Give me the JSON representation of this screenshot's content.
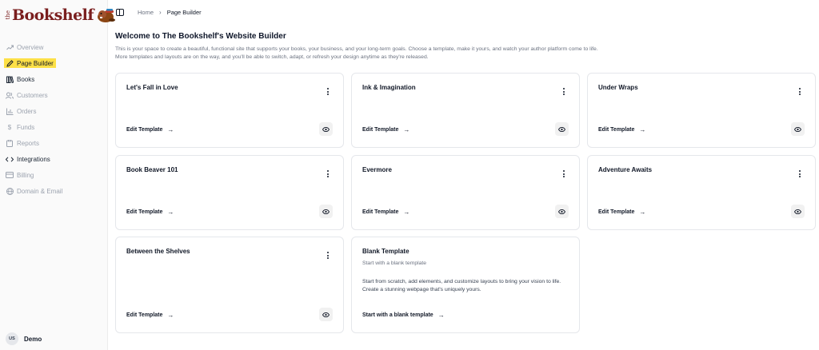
{
  "brand": {
    "the": "the",
    "name": "Bookshelf"
  },
  "sidebar": {
    "items": [
      {
        "label": "Overview",
        "icon": "trend-icon"
      },
      {
        "label": "Page Builder",
        "icon": "pencil-icon"
      },
      {
        "label": "Books",
        "icon": "books-icon"
      },
      {
        "label": "Customers",
        "icon": "users-icon"
      },
      {
        "label": "Orders",
        "icon": "bar-chart-icon"
      },
      {
        "label": "Funds",
        "icon": "dollar-icon"
      },
      {
        "label": "Reports",
        "icon": "clipboard-icon"
      },
      {
        "label": "Integrations",
        "icon": "code-arrows-icon"
      },
      {
        "label": "Billing",
        "icon": "credit-card-icon"
      },
      {
        "label": "Domain & Email",
        "icon": "globe-icon"
      }
    ],
    "user": {
      "initials": "US",
      "name": "Demo"
    }
  },
  "breadcrumb": {
    "home": "Home",
    "current": "Page Builder"
  },
  "main": {
    "title": "Welcome to The Bookshelf's Website Builder",
    "desc_line1": "This is your space to create a beautiful, functional site that supports your books, your business, and your long-term goals. Choose a template, make it yours, and watch your author platform come to life.",
    "desc_line2": "More templates and layouts are on the way, and you'll be able to switch, adapt, or refresh your design anytime as they're released."
  },
  "templates": [
    {
      "name": "Let's Fall in Love",
      "action": "Edit Template"
    },
    {
      "name": "Ink & Imagination",
      "action": "Edit Template"
    },
    {
      "name": "Under Wraps",
      "action": "Edit Template"
    },
    {
      "name": "Book Beaver 101",
      "action": "Edit Template"
    },
    {
      "name": "Evermore",
      "action": "Edit Template"
    },
    {
      "name": "Adventure Awaits",
      "action": "Edit Template"
    },
    {
      "name": "Between the Shelves",
      "action": "Edit Template"
    }
  ],
  "blank": {
    "title": "Blank Template",
    "subtitle": "Start with a blank template",
    "body": "Start from scratch, add elements, and customize layouts to bring your vision to life. Create a stunning webpage that's uniquely yours.",
    "action": "Start with a blank template"
  },
  "colors": {
    "highlight": "#fde047",
    "brand": "#7a1e1e"
  }
}
